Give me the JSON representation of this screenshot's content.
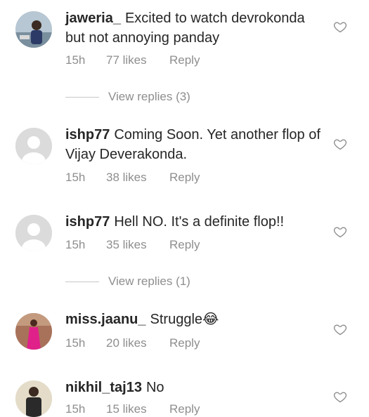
{
  "comments": [
    {
      "username": "jaweria_",
      "text": "Excited to watch devrokonda but not annoying panday",
      "time": "15h",
      "likes": "77 likes",
      "reply": "Reply",
      "view_replies": "View replies (3)"
    },
    {
      "username": "ishp77",
      "text": "Coming Soon. Yet another flop of Vijay Deverakonda.",
      "time": "15h",
      "likes": "38 likes",
      "reply": "Reply"
    },
    {
      "username": "ishp77",
      "text": "Hell NO. It's a definite flop!!",
      "time": "15h",
      "likes": "35 likes",
      "reply": "Reply",
      "view_replies": "View replies (1)"
    },
    {
      "username": "miss.jaanu_",
      "text": "Struggle😂",
      "time": "15h",
      "likes": "20 likes",
      "reply": "Reply"
    },
    {
      "username": "nikhil_taj13",
      "text": "No",
      "time": "15h",
      "likes": "15 likes",
      "reply": "Reply"
    }
  ],
  "icons": {
    "like": "heart-outline-icon",
    "default_avatar": "default-avatar-icon"
  },
  "colors": {
    "text": "#262626",
    "secondary": "#8e8e8e",
    "placeholder_avatar": "#dbdbdb"
  }
}
